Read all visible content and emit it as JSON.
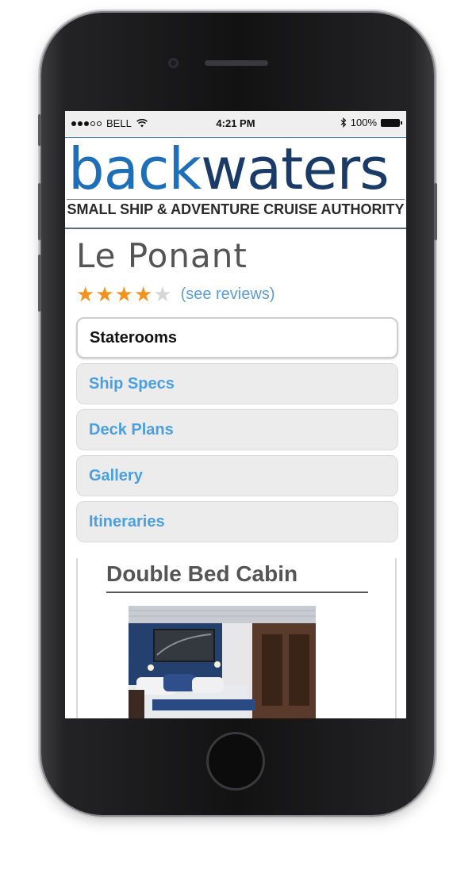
{
  "status_bar": {
    "carrier": "BELL",
    "time": "4:21 PM",
    "battery": "100%"
  },
  "header": {
    "logo_part1": "back",
    "logo_part2": "waters",
    "tagline": "SMALL SHIP & ADVENTURE CRUISE AUTHORITY"
  },
  "ship": {
    "name": "Le Ponant",
    "rating": 4,
    "rating_max": 5,
    "reviews_link": "(see reviews)"
  },
  "tabs": [
    {
      "label": "Staterooms",
      "active": true
    },
    {
      "label": "Ship Specs",
      "active": false
    },
    {
      "label": "Deck Plans",
      "active": false
    },
    {
      "label": "Gallery",
      "active": false
    },
    {
      "label": "Itineraries",
      "active": false
    }
  ],
  "cabin": {
    "title": "Double Bed Cabin"
  },
  "colors": {
    "brand_light_blue": "#1f6fb8",
    "brand_dark_blue": "#1a3b67",
    "link_blue": "#4a9fe2",
    "star_orange": "#f29320"
  }
}
